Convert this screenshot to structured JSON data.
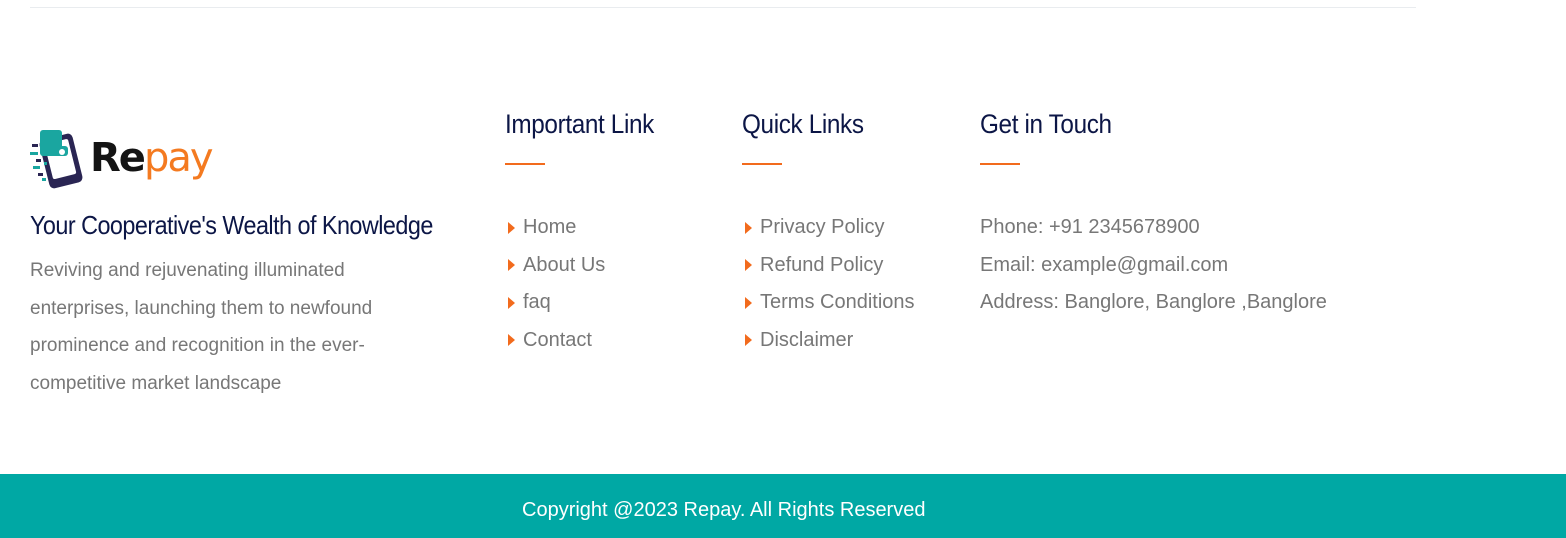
{
  "brand": {
    "logo_text_dark": "Re",
    "logo_text_accent": "pay",
    "logo_icon": "wallet-phone-icon",
    "tagline": "Your Cooperative's Wealth of Knowledge",
    "description": "Reviving and rejuvenating illuminated enterprises, launching them to newfound prominence and recognition in the ever-competitive market landscape"
  },
  "important_links": {
    "heading": "Important Link",
    "items": [
      {
        "label": "Home"
      },
      {
        "label": "About Us"
      },
      {
        "label": "faq"
      },
      {
        "label": "Contact"
      }
    ]
  },
  "quick_links": {
    "heading": "Quick Links",
    "items": [
      {
        "label": "Privacy Policy"
      },
      {
        "label": "Refund Policy"
      },
      {
        "label": "Terms Conditions"
      },
      {
        "label": "Disclaimer"
      }
    ]
  },
  "contact": {
    "heading": "Get in Touch",
    "phone": "Phone: +91 2345678900",
    "email": "Email: example@gmail.com",
    "address": "Address: Banglore, Banglore ,Banglore"
  },
  "footer": {
    "copyright": "Copyright @2023 Repay. All Rights Reserved"
  },
  "colors": {
    "accent": "#f26b1d",
    "heading": "#0c1646",
    "footer_bg": "#00a8a4",
    "body_text": "#777777"
  }
}
